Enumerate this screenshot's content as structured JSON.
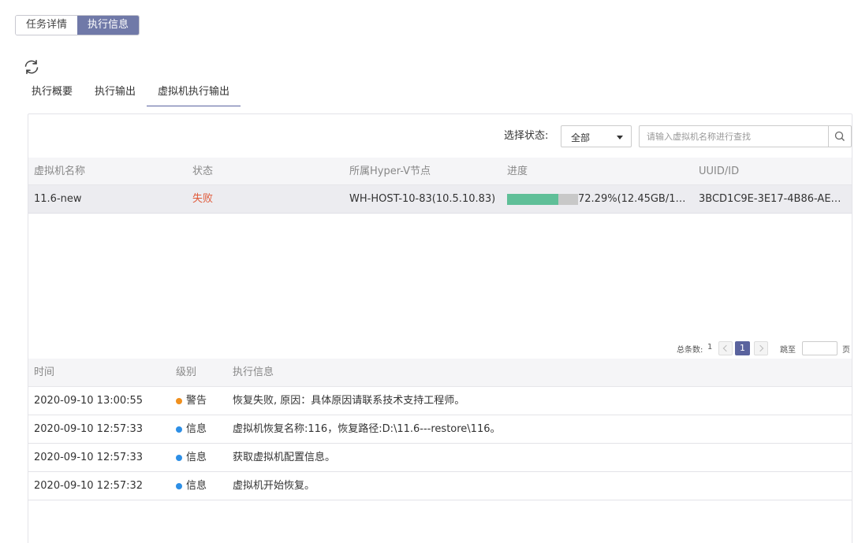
{
  "top_tabs": [
    {
      "label": "任务详情",
      "active": false
    },
    {
      "label": "执行信息",
      "active": true
    }
  ],
  "refresh_icon": "refresh-icon",
  "sub_tabs": [
    {
      "label": "执行概要",
      "active": false
    },
    {
      "label": "执行输出",
      "active": false
    },
    {
      "label": "虚拟机执行输出",
      "active": true
    }
  ],
  "filter": {
    "label": "选择状态:",
    "selected": "全部",
    "search_placeholder": "请输入虚拟机名称进行查找",
    "search_icon": "search-icon"
  },
  "vm_table": {
    "columns": [
      "虚拟机名称",
      "状态",
      "所属Hyper-V节点",
      "进度",
      "UUID/ID"
    ],
    "rows": [
      {
        "name": "11.6-new",
        "status": "失败",
        "node": "WH-HOST-10-83(10.5.10.83)",
        "progress": 0.7229,
        "progress_text": "72.29%(12.45GB/17.2…",
        "uuid": "3BCD1C9E-3E17-4B86-AE86-E…"
      }
    ]
  },
  "pagination": {
    "total_label": "总条数:",
    "total": "1",
    "current_page": "1",
    "jump_label": "跳至",
    "page_label": "页"
  },
  "log_table": {
    "columns": [
      "时间",
      "级别",
      "执行信息"
    ],
    "rows": [
      {
        "time": "2020-09-10 13:00:55",
        "level": "警告",
        "level_color": "#f0901e",
        "message": "恢复失败, 原因：具体原因请联系技术支持工程师。"
      },
      {
        "time": "2020-09-10 12:57:33",
        "level": "信息",
        "level_color": "#2d8fe6",
        "message": "虚拟机恢复名称:116，恢复路径:D:\\11.6---restore\\116。"
      },
      {
        "time": "2020-09-10 12:57:33",
        "level": "信息",
        "level_color": "#2d8fe6",
        "message": "获取虚拟机配置信息。"
      },
      {
        "time": "2020-09-10 12:57:32",
        "level": "信息",
        "level_color": "#2d8fe6",
        "message": "虚拟机开始恢复。"
      }
    ]
  },
  "colors": {
    "accent": "#7079a8",
    "progress_fill": "#5fbf98",
    "fail": "#e05a3a"
  }
}
